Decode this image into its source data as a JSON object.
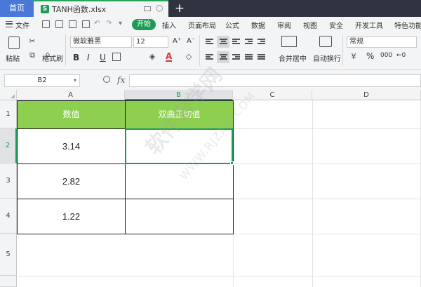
{
  "tabs": {
    "home": "首页",
    "file_name": "TANH函数.xlsx",
    "file_icon": "S",
    "add_icon": "+"
  },
  "menu": {
    "file": "文件",
    "items": [
      "开始",
      "插入",
      "页面布局",
      "公式",
      "数据",
      "审阅",
      "视图",
      "安全",
      "开发工具",
      "特色功能"
    ]
  },
  "ribbon": {
    "paste": "粘贴",
    "format_painter": "格式刷",
    "font_name": "微软雅黑",
    "font_size": "12",
    "bold": "B",
    "italic": "I",
    "underline": "U",
    "merge_center": "合并居中",
    "auto_wrap": "自动换行",
    "number_format": "常规",
    "percent": "%",
    "comma_style": "000",
    "font_grow": "A⁺",
    "font_shrink": "A⁻",
    "font_color_glyph": "A"
  },
  "formula_bar": {
    "cell_ref": "B2",
    "fx": "fx",
    "formula": ""
  },
  "sheet": {
    "columns": [
      "A",
      "B",
      "C",
      "D"
    ],
    "rows": [
      "1",
      "2",
      "3",
      "4",
      "5"
    ],
    "header": [
      "数值",
      "双曲正切值"
    ],
    "values": [
      "3.14",
      "2.82",
      "1.22"
    ],
    "selected_cell": "B2"
  },
  "watermark": {
    "main": "软件自学网",
    "sub": "WWW.RJZXW.COM"
  },
  "colors": {
    "accent_green": "#1e9b55",
    "header_fill": "#8dd050",
    "home_tab": "#4a78d8",
    "titlebar": "#2f3440"
  }
}
